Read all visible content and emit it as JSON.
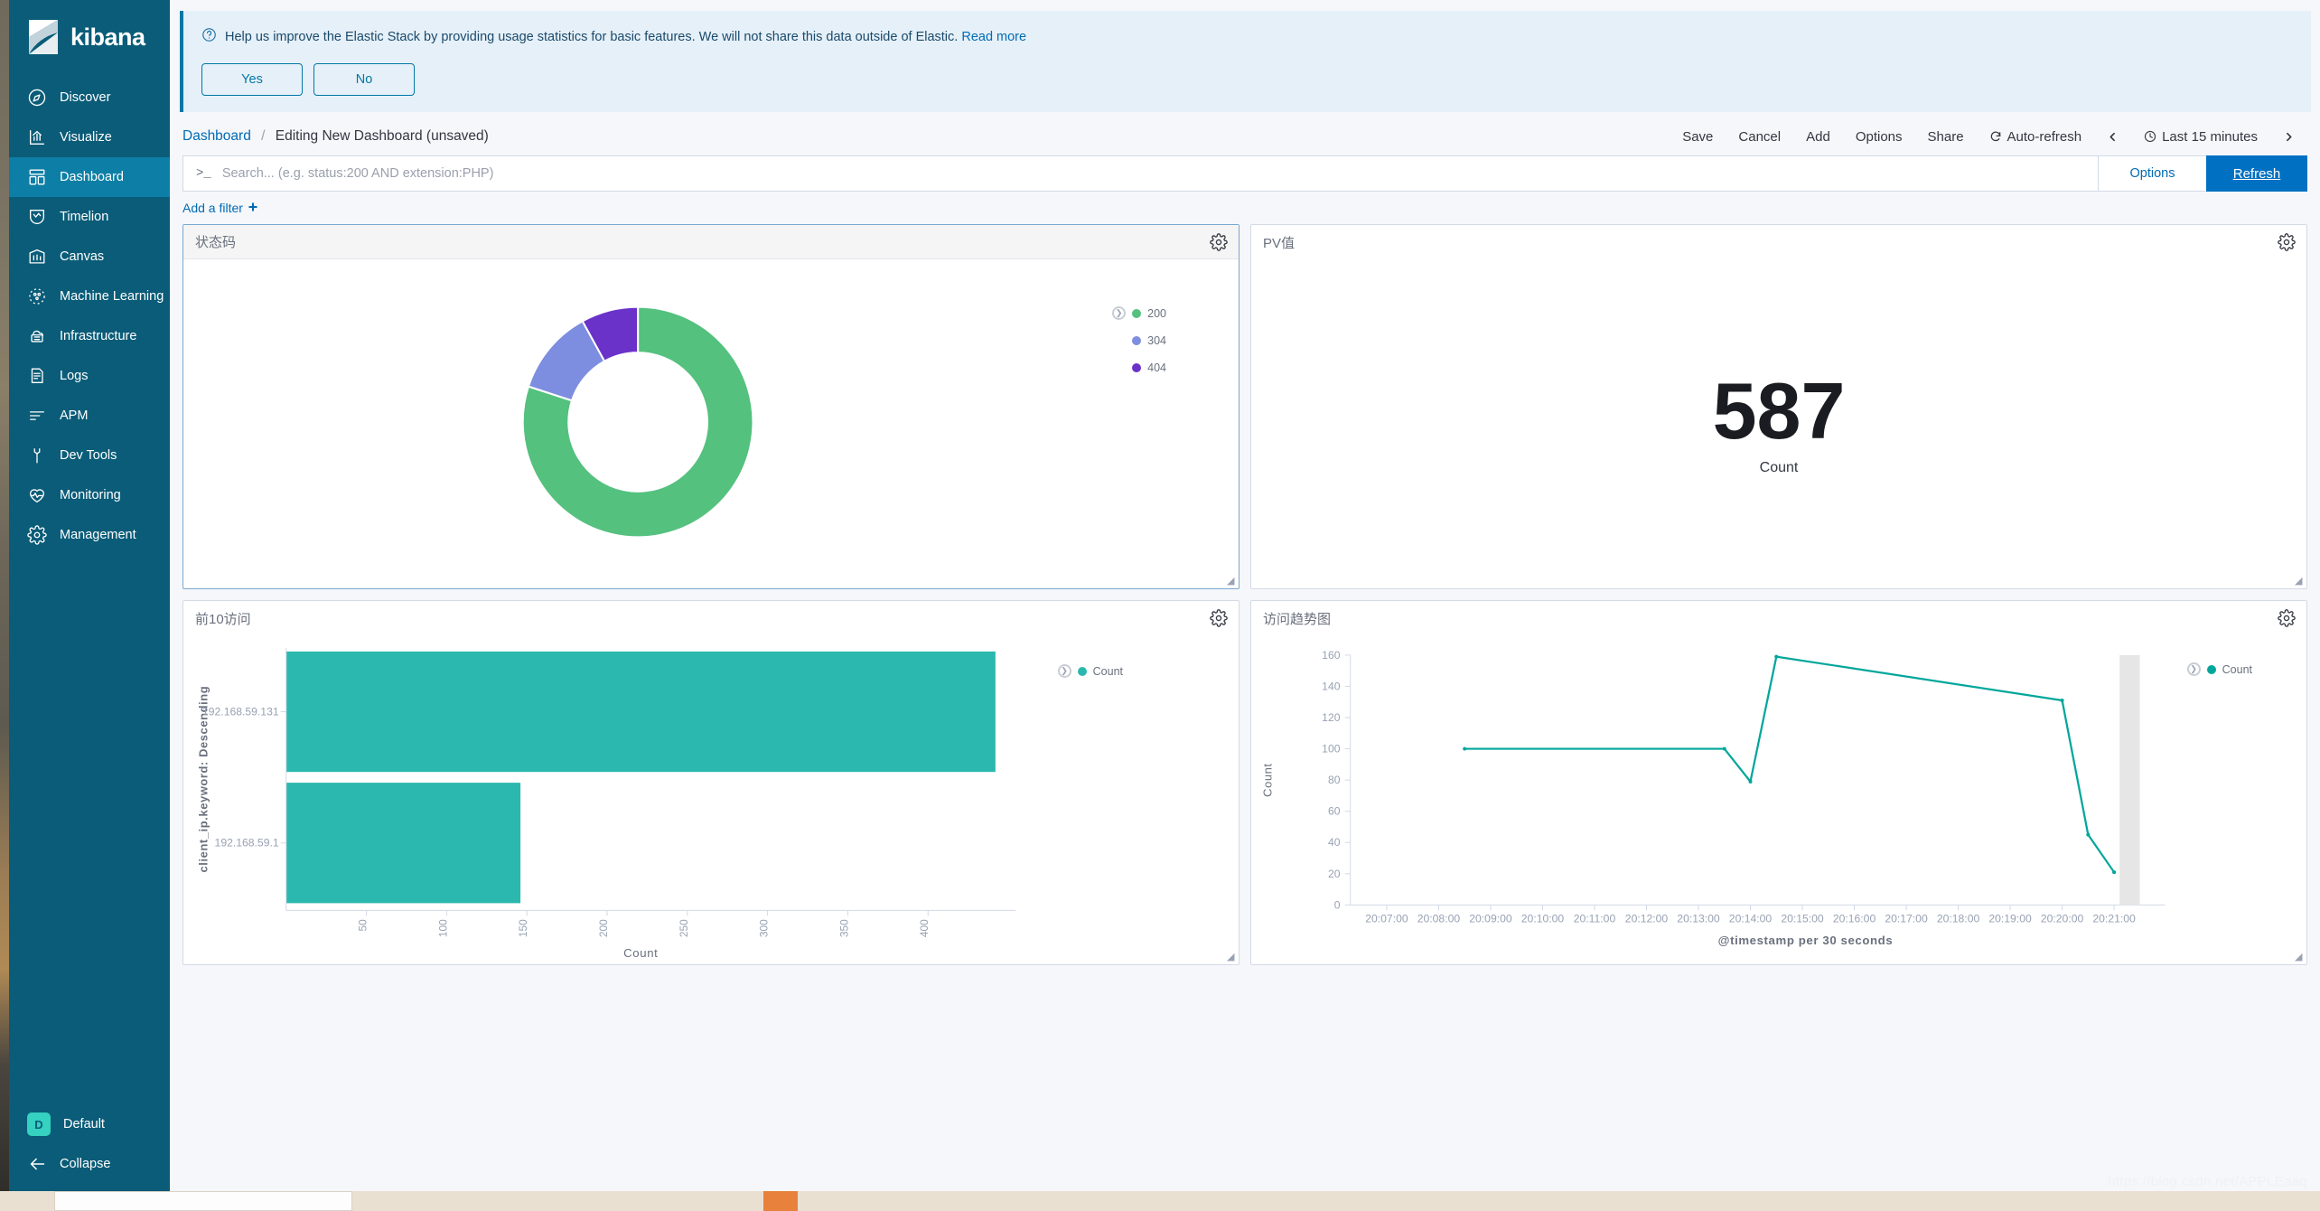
{
  "app": {
    "brand": "kibana"
  },
  "sidebar": {
    "items": [
      {
        "label": "Discover",
        "icon": "compass-icon",
        "active": false
      },
      {
        "label": "Visualize",
        "icon": "bar-chart-icon",
        "active": false
      },
      {
        "label": "Dashboard",
        "icon": "dashboard-grid-icon",
        "active": true
      },
      {
        "label": "Timelion",
        "icon": "timelion-icon",
        "active": false
      },
      {
        "label": "Canvas",
        "icon": "canvas-icon",
        "active": false
      },
      {
        "label": "Machine Learning",
        "icon": "machine-learning-icon",
        "active": false
      },
      {
        "label": "Infrastructure",
        "icon": "infrastructure-icon",
        "active": false
      },
      {
        "label": "Logs",
        "icon": "logs-icon",
        "active": false
      },
      {
        "label": "APM",
        "icon": "apm-icon",
        "active": false
      },
      {
        "label": "Dev Tools",
        "icon": "wrench-icon",
        "active": false
      },
      {
        "label": "Monitoring",
        "icon": "heartbeat-icon",
        "active": false
      },
      {
        "label": "Management",
        "icon": "gear-icon",
        "active": false
      }
    ],
    "space": {
      "initial": "D",
      "label": "Default"
    },
    "collapse": {
      "label": "Collapse",
      "icon": "arrow-left-icon"
    }
  },
  "banner": {
    "icon": "question-circle-icon",
    "message": "Help us improve the Elastic Stack by providing usage statistics for basic features. We will not share this data outside of Elastic.",
    "link": "Read more",
    "yes_label": "Yes",
    "no_label": "No"
  },
  "breadcrumb": {
    "root": "Dashboard",
    "separator": "/",
    "current": "Editing New Dashboard (unsaved)"
  },
  "toolbar": {
    "save_label": "Save",
    "cancel_label": "Cancel",
    "add_label": "Add",
    "options_label": "Options",
    "share_label": "Share",
    "autorefresh_label": "Auto-refresh",
    "time_range_label": "Last 15 minutes",
    "prev_icon": "chevron-left-icon",
    "next_icon": "chevron-right-icon",
    "clock_icon": "clock-icon",
    "refresh_cycle_icon": "refresh-cycle-icon"
  },
  "query": {
    "prompt": ">_",
    "placeholder": "Search... (e.g. status:200 AND extension:PHP)",
    "value": "",
    "options_label": "Options",
    "refresh_label": "Refresh"
  },
  "filters": {
    "add_label": "Add a filter",
    "add_icon": "plus-icon"
  },
  "panels": [
    {
      "title": "状态码",
      "gear_icon": "gear-icon"
    },
    {
      "title": "PV值",
      "gear_icon": "gear-icon"
    },
    {
      "title": "前10访问",
      "gear_icon": "gear-icon"
    },
    {
      "title": "访问趋势图",
      "gear_icon": "gear-icon"
    }
  ],
  "metric": {
    "value": "587",
    "label": "Count"
  },
  "watermark": "https://blog.csdn.net/APPLEaaq",
  "chart_data": [
    {
      "id": "status-code-donut",
      "type": "pie",
      "title": "状态码",
      "donut": true,
      "legend_position": "right",
      "labels": [
        "200",
        "304",
        "404"
      ],
      "values": [
        80,
        12,
        8
      ],
      "colors": [
        "#54c17f",
        "#7d8ee0",
        "#6a32c9"
      ]
    },
    {
      "id": "pv-metric",
      "type": "table",
      "title": "PV值",
      "labels": [
        "Count"
      ],
      "values": [
        587
      ]
    },
    {
      "id": "top10-visits-bar",
      "type": "bar",
      "title": "前10访问",
      "orientation": "horizontal",
      "categories": [
        "192.168.59.131",
        "192.168.59.1"
      ],
      "values": [
        442,
        146
      ],
      "xlabel": "Count",
      "ylabel": "client_ip.keyword: Descending",
      "xlim": [
        0,
        442
      ],
      "xticks": [
        50,
        100,
        150,
        200,
        250,
        300,
        350,
        400
      ],
      "legend": [
        "Count"
      ],
      "legend_position": "right",
      "colors": [
        "#2bb8ae"
      ],
      "grid": false
    },
    {
      "id": "visit-trend-line",
      "type": "line",
      "title": "访问趋势图",
      "xlabel": "@timestamp per 30 seconds",
      "ylabel": "Count",
      "ylim": [
        0,
        160
      ],
      "yticks": [
        0,
        20,
        40,
        60,
        80,
        100,
        120,
        140,
        160
      ],
      "xticks": [
        "20:07:00",
        "20:08:00",
        "20:09:00",
        "20:10:00",
        "20:11:00",
        "20:12:00",
        "20:13:00",
        "20:14:00",
        "20:15:00",
        "20:16:00",
        "20:17:00",
        "20:18:00",
        "20:19:00",
        "20:20:00",
        "20:21:00"
      ],
      "x": [
        "20:08:30",
        "20:13:30",
        "20:14:00",
        "20:14:30",
        "20:20:00",
        "20:20:30",
        "20:21:00"
      ],
      "values": [
        100,
        100,
        79,
        159,
        131,
        45,
        21
      ],
      "legend": [
        "Count"
      ],
      "legend_position": "right",
      "colors": [
        "#00a69b"
      ],
      "grid": false
    }
  ]
}
